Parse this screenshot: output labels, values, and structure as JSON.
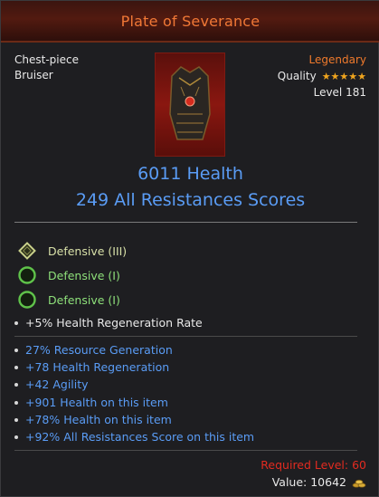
{
  "item": {
    "name": "Plate of Severance",
    "slot": "Chest-piece",
    "class": "Bruiser",
    "rarity": "Legendary",
    "quality_label": "Quality",
    "quality_stars": "★★★★★",
    "quality_value": 5,
    "level": "Level 181"
  },
  "primary_stats": [
    "6011 Health",
    "249 All Resistances Scores"
  ],
  "sockets": [
    {
      "label": "Defensive (III)",
      "icon": "diamond-socket-icon"
    },
    {
      "label": "Defensive (I)",
      "icon": "ring-socket-icon"
    },
    {
      "label": "Defensive (I)",
      "icon": "ring-socket-icon"
    }
  ],
  "implicit_stat": "+5% Health Regeneration Rate",
  "affixes": [
    "27% Resource Generation",
    "+78 Health Regeneration",
    "+42 Agility",
    "+901 Health on this item",
    "+78% Health on this item",
    "+92% All Resistances Score on this item"
  ],
  "requirements": {
    "required_level": "Required Level: 60"
  },
  "value": {
    "text": "Value: 10642",
    "icon": "gold-coins-icon"
  },
  "colors": {
    "title": "#f07836",
    "legendary": "#f07a2c",
    "stat_blue": "#5a9cf5",
    "socket_text": "#d8e0a8",
    "requirement_red": "#e22b20"
  }
}
